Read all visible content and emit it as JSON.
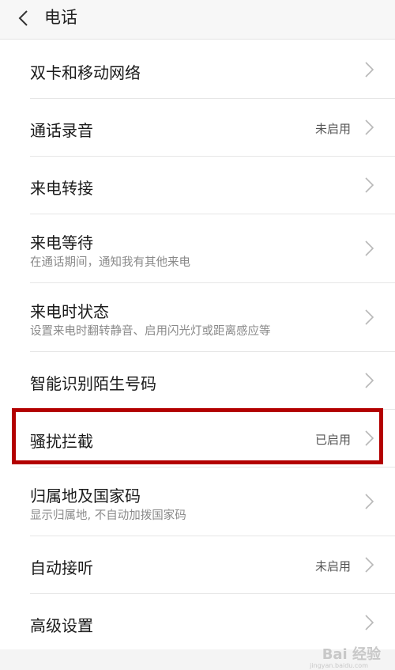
{
  "header": {
    "title": "电话",
    "back_icon": "chevron-left-icon"
  },
  "items": [
    {
      "id": "dual-sim",
      "title": "双卡和移动网络",
      "subtitle": "",
      "status": ""
    },
    {
      "id": "call-recording",
      "title": "通话录音",
      "subtitle": "",
      "status": "未启用"
    },
    {
      "id": "call-forwarding",
      "title": "来电转接",
      "subtitle": "",
      "status": ""
    },
    {
      "id": "call-waiting",
      "title": "来电等待",
      "subtitle": "在通话期间，通知我有其他来电",
      "status": ""
    },
    {
      "id": "incoming-state",
      "title": "来电时状态",
      "subtitle": "设置来电时翻转静音、启用闪光灯或距离感应等",
      "status": ""
    },
    {
      "id": "caller-id",
      "title": "智能识别陌生号码",
      "subtitle": "",
      "status": ""
    },
    {
      "id": "spam-block",
      "title": "骚扰拦截",
      "subtitle": "",
      "status": "已启用"
    },
    {
      "id": "location-code",
      "title": "归属地及国家码",
      "subtitle": "显示归属地, 不自动加拨国家码",
      "status": ""
    },
    {
      "id": "auto-answer",
      "title": "自动接听",
      "subtitle": "",
      "status": "未启用"
    },
    {
      "id": "advanced",
      "title": "高级设置",
      "subtitle": "",
      "status": ""
    }
  ],
  "watermark": {
    "text": "Bai 经验",
    "sub": "jingyan.baidu.com"
  },
  "colors": {
    "highlight": "#b30000",
    "header_bg": "#f7f7f7"
  }
}
